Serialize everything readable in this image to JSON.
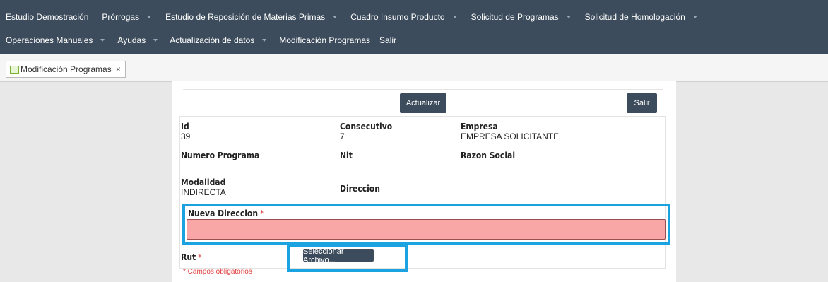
{
  "nav": {
    "row1": [
      {
        "label": "Estudio Demostración",
        "caret": false
      },
      {
        "label": "Prórrogas",
        "caret": true
      },
      {
        "label": "Estudio de Reposición de Materias Primas",
        "caret": true
      },
      {
        "label": "Cuadro Insumo Producto",
        "caret": true
      },
      {
        "label": "Solicitud de Programas",
        "caret": true
      },
      {
        "label": "Solicitud de Homologación",
        "caret": true
      }
    ],
    "row2": [
      {
        "label": "Operaciones Manuales",
        "caret": true
      },
      {
        "label": "Ayudas",
        "caret": true
      },
      {
        "label": "Actualización de datos",
        "caret": true
      },
      {
        "label": "Modificación Programas",
        "caret": false
      },
      {
        "label": "Salir",
        "caret": false
      }
    ]
  },
  "tab": {
    "label": "Modificación Programas",
    "close": "×"
  },
  "buttons": {
    "update": "Actualizar",
    "exit": "Salir",
    "file": "Seleccionar Archivo..."
  },
  "fields": {
    "id_label": "Id",
    "id_value": "39",
    "consecutivo_label": "Consecutivo",
    "consecutivo_value": "7",
    "empresa_label": "Empresa",
    "empresa_value": "EMPRESA SOLICITANTE",
    "numero_programa_label": "Numero Programa",
    "nit_label": "Nit",
    "razon_social_label": "Razon Social",
    "modalidad_label": "Modalidad",
    "modalidad_value": "INDIRECTA",
    "direccion_label": "Direccion",
    "nueva_direccion_label": "Nueva Direccion",
    "nueva_direccion_value": "",
    "rut_label": "Rut",
    "required_mark": "*"
  },
  "footer_note": "* Campos obligatorios",
  "colors": {
    "navbar": "#3c4c5c",
    "highlight": "#1aa3e0",
    "error_field": "#f8a6a6",
    "required": "#e04040"
  }
}
